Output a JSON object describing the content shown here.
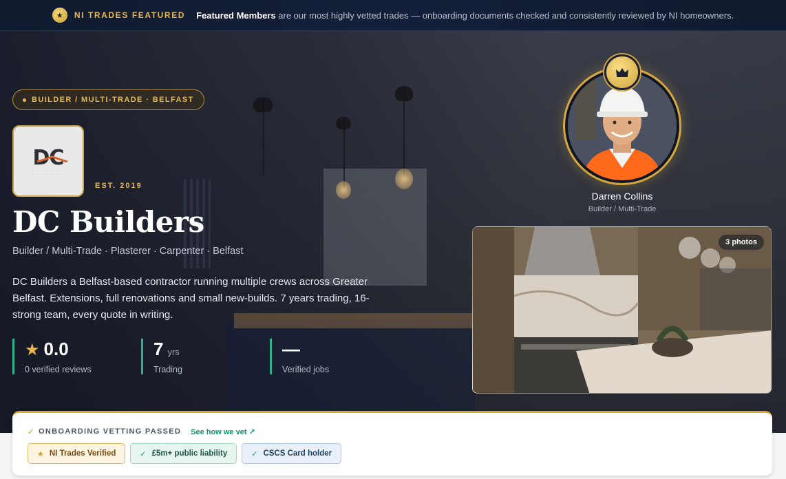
{
  "banner": {
    "tag": "NI TRADES FEATURED",
    "bold": "Featured Members",
    "text": " are our most highly vetted trades — onboarding documents checked and consistently reviewed by NI homeowners."
  },
  "hero": {
    "category": "BUILDER / MULTI-TRADE · BELFAST",
    "logo_text": "DC",
    "established": "EST. 2019",
    "business_name": "DC Builders",
    "trades": "Builder / Multi-Trade · Plasterer · Carpenter · Belfast",
    "description": "DC Builders a Belfast-based contractor running multiple crews across Greater Belfast. Extensions, full renovations and small new-builds. 7 years trading, 16-strong team, every quote in writing.",
    "stats": [
      {
        "value": "0.0",
        "unit": "",
        "label": "0 verified reviews",
        "icon": "star-icon"
      },
      {
        "value": "7",
        "unit": "yrs",
        "label": "Trading"
      },
      {
        "value": "—",
        "unit": "",
        "label": "Verified jobs"
      }
    ]
  },
  "owner": {
    "name": "Darren Collins",
    "role": "Builder / Multi-Trade",
    "badge_icon": "crown-icon"
  },
  "gallery": {
    "photo_count": "3 photos"
  },
  "vetting": {
    "title": "ONBOARDING VETTING PASSED",
    "link": "See how we vet ↗",
    "badges": [
      {
        "label": "NI Trades Verified",
        "style": "gold"
      },
      {
        "label": "£5m+ public liability",
        "style": "green"
      },
      {
        "label": "CSCS Card holder",
        "style": "blue"
      }
    ]
  },
  "colors": {
    "accent_gold": "#e8b94a",
    "accent_green": "#2fb38a",
    "banner_bg": "#101a2e"
  }
}
